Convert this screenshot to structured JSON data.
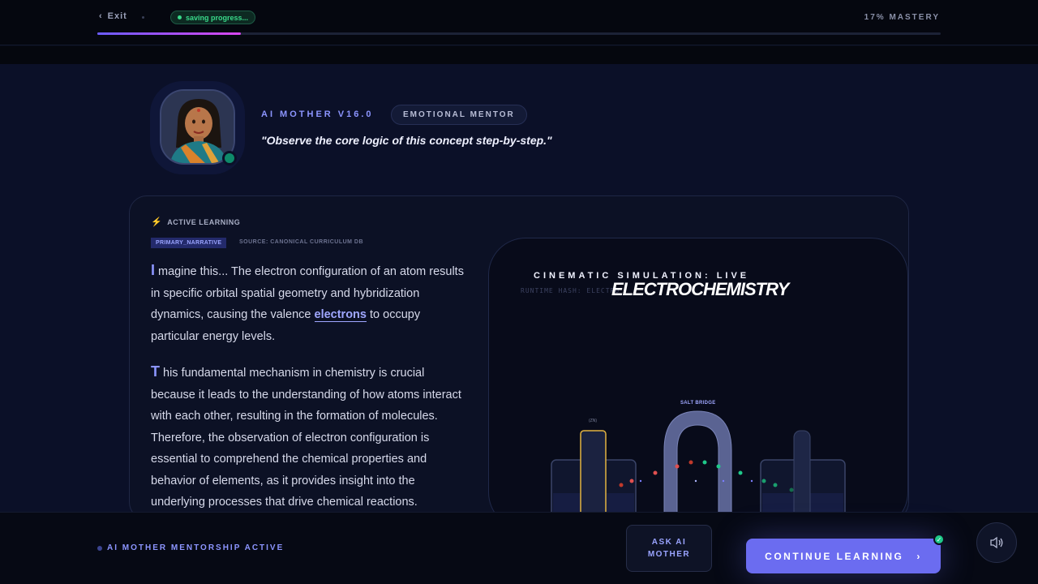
{
  "header": {
    "exit_label": "Exit",
    "saving_label": "saving progress...",
    "mastery_label": "17% MASTERY",
    "progress_fraction": 0.17
  },
  "mentor": {
    "name": "AI MOTHER V16.0",
    "role": "EMOTIONAL MENTOR",
    "quote": "\"Observe the core logic of this concept step-by-step.\"",
    "status_color": "#0e8a6a"
  },
  "lesson": {
    "section_label": "ACTIVE LEARNING",
    "tag": "PRIMARY_NARRATIVE",
    "source": "SOURCE: CANONICAL CURRICULUM DB",
    "p1_cap": "I",
    "p1_a": "magine this... The electron configuration of an atom results in specific orbital spatial geometry and hybridization dynamics, causing the valence ",
    "p1_highlight": "electrons",
    "p1_b": " to occupy particular energy levels.",
    "p2_cap": "T",
    "p2_text": "his fundamental mechanism in chemistry is crucial because it leads to the understanding of how atoms interact with each other, resulting in the formation of molecules. Therefore, the observation of electron configuration is essential to comprehend the chemical properties and behavior of elements, as it provides insight into the underlying processes that drive chemical reactions."
  },
  "simulation": {
    "title": "CINEMATIC SIMULATION: LIVE",
    "hash": "RUNTIME HASH: ELECTRO",
    "subject": "ELECTROCHEMISTRY",
    "salt_bridge_label": "SALT BRIDGE",
    "anode_label": "(ZN)"
  },
  "footer": {
    "status": "AI MOTHER MENTORSHIP ACTIVE",
    "ask_label": "ASK AI MOTHER",
    "continue_label": "CONTINUE LEARNING"
  },
  "icons": {
    "back": "chevron-left-icon",
    "bolt": "bolt-icon",
    "next": "chevron-right-icon",
    "sound": "speaker-icon",
    "check": "check-icon"
  },
  "colors": {
    "accent": "#8c95ff",
    "button": "#6b6cf0",
    "success": "#39d98a"
  }
}
